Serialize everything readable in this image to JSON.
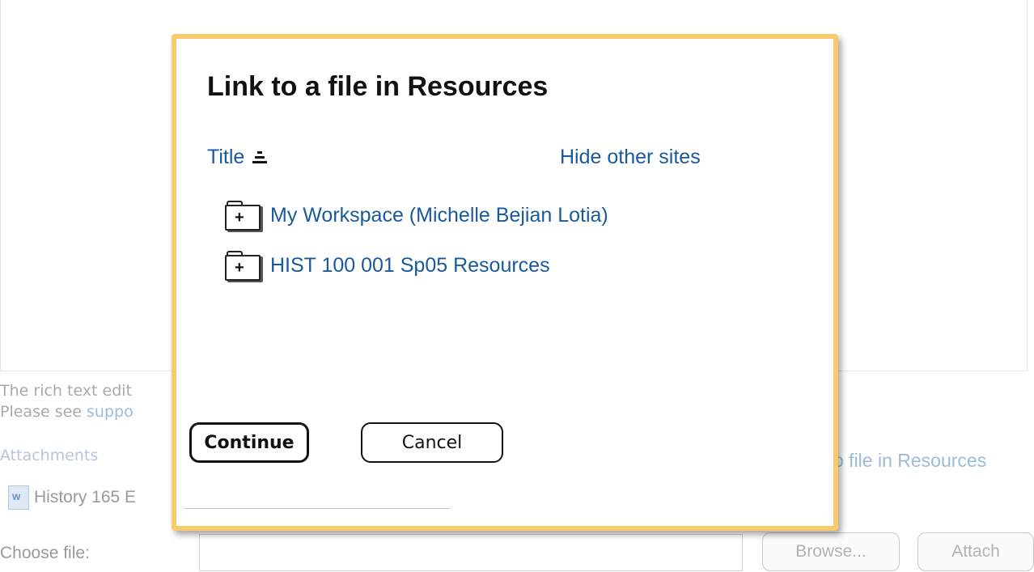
{
  "background": {
    "editor_note_line1": "The rich text edit",
    "editor_note_line2_prefix": "Please see ",
    "editor_note_link": "suppo",
    "attachments_label": "Attachments",
    "attachment_name": "History 165 E",
    "link_resources_text": "o file in Resources",
    "choose_file_label": "Choose file:",
    "browse_button": "Browse...",
    "attach_button": "Attach"
  },
  "dialog": {
    "title": "Link to a file in Resources",
    "column_header": "Title",
    "hide_other_sites": "Hide other sites",
    "items": [
      {
        "label": "My Workspace (Michelle Bejian Lotia)",
        "expander": "+"
      },
      {
        "label": "HIST 100 001 Sp05 Resources",
        "expander": "+"
      }
    ],
    "continue_label": "Continue",
    "cancel_label": "Cancel"
  },
  "colors": {
    "dialog_border": "#f9cb6c",
    "link": "#1a5a9a"
  },
  "icons": [
    "sort-ascending-icon",
    "folder-expand-icon",
    "word-document-icon"
  ]
}
